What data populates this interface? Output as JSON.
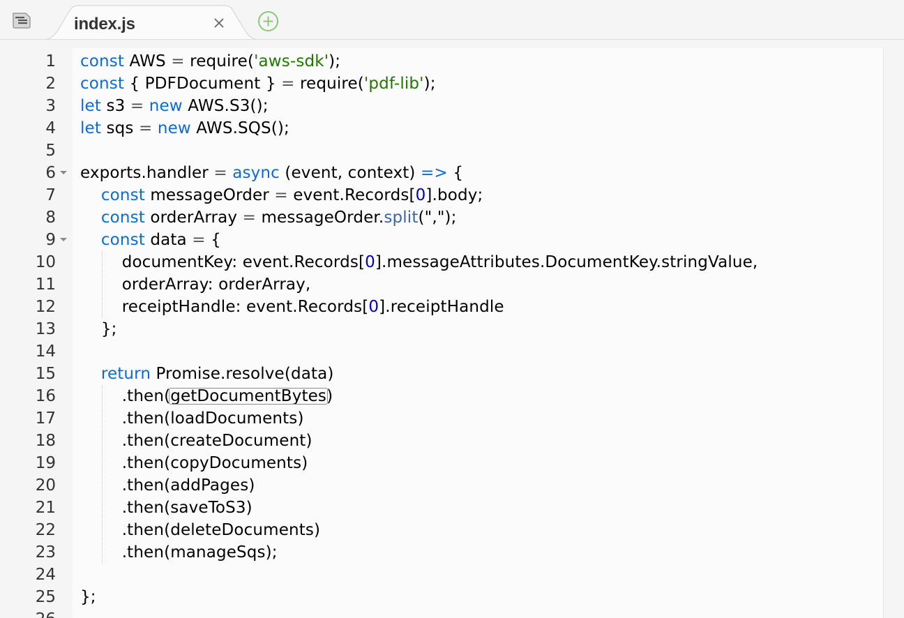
{
  "tab": {
    "title": "index.js",
    "close_icon": "close-icon",
    "add_icon": "add-tab-icon",
    "menu_icon": "file-menu-icon"
  },
  "colors": {
    "keyword": "#0d6bd9",
    "string": "#207800",
    "number": "#0000cd",
    "plain": "#000000"
  },
  "editor": {
    "highlighted_word": "getDocumentBytes",
    "lines": [
      {
        "n": "1",
        "fold": false,
        "tokens": [
          {
            "t": "kw",
            "v": "const"
          },
          {
            "t": "p",
            "v": " AWS "
          },
          {
            "t": "op",
            "v": "="
          },
          {
            "t": "p",
            "v": " require("
          },
          {
            "t": "str",
            "v": "'aws-sdk'"
          },
          {
            "t": "p",
            "v": ");"
          }
        ]
      },
      {
        "n": "2",
        "fold": false,
        "tokens": [
          {
            "t": "kw",
            "v": "const"
          },
          {
            "t": "p",
            "v": " { PDFDocument } "
          },
          {
            "t": "op",
            "v": "="
          },
          {
            "t": "p",
            "v": " require("
          },
          {
            "t": "str",
            "v": "'pdf-lib'"
          },
          {
            "t": "p",
            "v": ");"
          }
        ]
      },
      {
        "n": "3",
        "fold": false,
        "tokens": [
          {
            "t": "kw",
            "v": "let"
          },
          {
            "t": "p",
            "v": " s3 "
          },
          {
            "t": "op",
            "v": "="
          },
          {
            "t": "p",
            "v": " "
          },
          {
            "t": "kw",
            "v": "new"
          },
          {
            "t": "p",
            "v": " AWS.S3();"
          }
        ]
      },
      {
        "n": "4",
        "fold": false,
        "tokens": [
          {
            "t": "kw",
            "v": "let"
          },
          {
            "t": "p",
            "v": " sqs "
          },
          {
            "t": "op",
            "v": "="
          },
          {
            "t": "p",
            "v": " "
          },
          {
            "t": "kw",
            "v": "new"
          },
          {
            "t": "p",
            "v": " AWS.SQS();"
          }
        ]
      },
      {
        "n": "5",
        "fold": false,
        "tokens": []
      },
      {
        "n": "6",
        "fold": true,
        "tokens": [
          {
            "t": "p",
            "v": "exports.handler "
          },
          {
            "t": "op",
            "v": "="
          },
          {
            "t": "p",
            "v": " "
          },
          {
            "t": "kw",
            "v": "async"
          },
          {
            "t": "p",
            "v": " (event, context) "
          },
          {
            "t": "kw",
            "v": "=>"
          },
          {
            "t": "p",
            "v": " {"
          }
        ]
      },
      {
        "n": "7",
        "fold": false,
        "tokens": [
          {
            "t": "p",
            "v": "    "
          },
          {
            "t": "kw",
            "v": "const"
          },
          {
            "t": "p",
            "v": " messageOrder "
          },
          {
            "t": "op",
            "v": "="
          },
          {
            "t": "p",
            "v": " event.Records["
          },
          {
            "t": "num",
            "v": "0"
          },
          {
            "t": "p",
            "v": "].body;"
          }
        ]
      },
      {
        "n": "8",
        "fold": false,
        "tokens": [
          {
            "t": "p",
            "v": "    "
          },
          {
            "t": "kw",
            "v": "const"
          },
          {
            "t": "p",
            "v": " orderArray "
          },
          {
            "t": "op",
            "v": "="
          },
          {
            "t": "p",
            "v": " messageOrder."
          },
          {
            "t": "fn",
            "v": "split"
          },
          {
            "t": "p",
            "v": "(\",\");"
          }
        ]
      },
      {
        "n": "9",
        "fold": true,
        "tokens": [
          {
            "t": "p",
            "v": "    "
          },
          {
            "t": "kw",
            "v": "const"
          },
          {
            "t": "p",
            "v": " data "
          },
          {
            "t": "op",
            "v": "="
          },
          {
            "t": "p",
            "v": " {"
          }
        ]
      },
      {
        "n": "10",
        "fold": false,
        "tokens": [
          {
            "t": "p",
            "v": "        documentKey: event.Records["
          },
          {
            "t": "num",
            "v": "0"
          },
          {
            "t": "p",
            "v": "].messageAttributes.DocumentKey.stringValue,"
          }
        ]
      },
      {
        "n": "11",
        "fold": false,
        "tokens": [
          {
            "t": "p",
            "v": "        orderArray: orderArray,"
          }
        ]
      },
      {
        "n": "12",
        "fold": false,
        "tokens": [
          {
            "t": "p",
            "v": "        receiptHandle: event.Records["
          },
          {
            "t": "num",
            "v": "0"
          },
          {
            "t": "p",
            "v": "].receiptHandle"
          }
        ]
      },
      {
        "n": "13",
        "fold": false,
        "tokens": [
          {
            "t": "p",
            "v": "    };"
          }
        ]
      },
      {
        "n": "14",
        "fold": false,
        "tokens": []
      },
      {
        "n": "15",
        "fold": false,
        "tokens": [
          {
            "t": "p",
            "v": "    "
          },
          {
            "t": "kw",
            "v": "return"
          },
          {
            "t": "p",
            "v": " Promise.resolve(data)"
          }
        ]
      },
      {
        "n": "16",
        "fold": false,
        "tokens": [
          {
            "t": "p",
            "v": "        .then("
          },
          {
            "t": "hl",
            "v": "getDocumentBytes"
          },
          {
            "t": "p",
            "v": ")"
          }
        ]
      },
      {
        "n": "17",
        "fold": false,
        "tokens": [
          {
            "t": "p",
            "v": "        .then(loadDocuments)"
          }
        ]
      },
      {
        "n": "18",
        "fold": false,
        "tokens": [
          {
            "t": "p",
            "v": "        .then(createDocument)"
          }
        ]
      },
      {
        "n": "19",
        "fold": false,
        "tokens": [
          {
            "t": "p",
            "v": "        .then(copyDocuments)"
          }
        ]
      },
      {
        "n": "20",
        "fold": false,
        "tokens": [
          {
            "t": "p",
            "v": "        .then(addPages)"
          }
        ]
      },
      {
        "n": "21",
        "fold": false,
        "tokens": [
          {
            "t": "p",
            "v": "        .then(saveToS3)"
          }
        ]
      },
      {
        "n": "22",
        "fold": false,
        "tokens": [
          {
            "t": "p",
            "v": "        .then(deleteDocuments)"
          }
        ]
      },
      {
        "n": "23",
        "fold": false,
        "tokens": [
          {
            "t": "p",
            "v": "        .then(manageSqs);"
          }
        ]
      },
      {
        "n": "24",
        "fold": false,
        "tokens": []
      },
      {
        "n": "25",
        "fold": false,
        "tokens": [
          {
            "t": "p",
            "v": "};"
          }
        ]
      },
      {
        "n": "26",
        "fold": false,
        "tokens": []
      }
    ]
  }
}
